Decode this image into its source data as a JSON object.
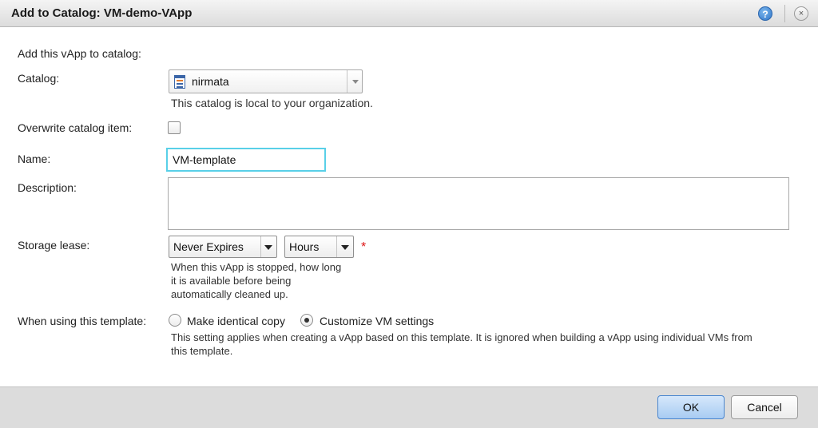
{
  "dialog": {
    "title": "Add to Catalog: VM-demo-VApp",
    "help_icon": "?",
    "close_icon": "×"
  },
  "form": {
    "intro": "Add this vApp to catalog:",
    "catalog": {
      "label": "Catalog:",
      "value": "nirmata",
      "hint": "This catalog is local to your organization."
    },
    "overwrite": {
      "label": "Overwrite catalog item:",
      "checked": false
    },
    "name": {
      "label": "Name:",
      "value": "VM-template"
    },
    "description": {
      "label": "Description:",
      "value": ""
    },
    "storage_lease": {
      "label": "Storage lease:",
      "duration_value": "Never Expires",
      "unit_value": "Hours",
      "required_mark": "*",
      "hint_lines": [
        "When this vApp is stopped, how long",
        "it is available before being",
        "automatically cleaned up."
      ]
    },
    "template_usage": {
      "label": "When using this template:",
      "options": [
        {
          "label": "Make identical copy",
          "selected": false
        },
        {
          "label": "Customize VM settings",
          "selected": true
        }
      ],
      "hint_lines": [
        "This setting applies when creating a vApp based on this template. It is ignored when building a vApp using individual VMs from",
        "this template."
      ]
    }
  },
  "footer": {
    "ok_label": "OK",
    "cancel_label": "Cancel"
  },
  "colors": {
    "focus_border": "#59d0e8",
    "primary_button": "#a8cbf2",
    "required": "#dd1111"
  },
  "icons": {
    "help": "help-icon",
    "close": "close-icon",
    "catalog": "catalog-icon"
  }
}
